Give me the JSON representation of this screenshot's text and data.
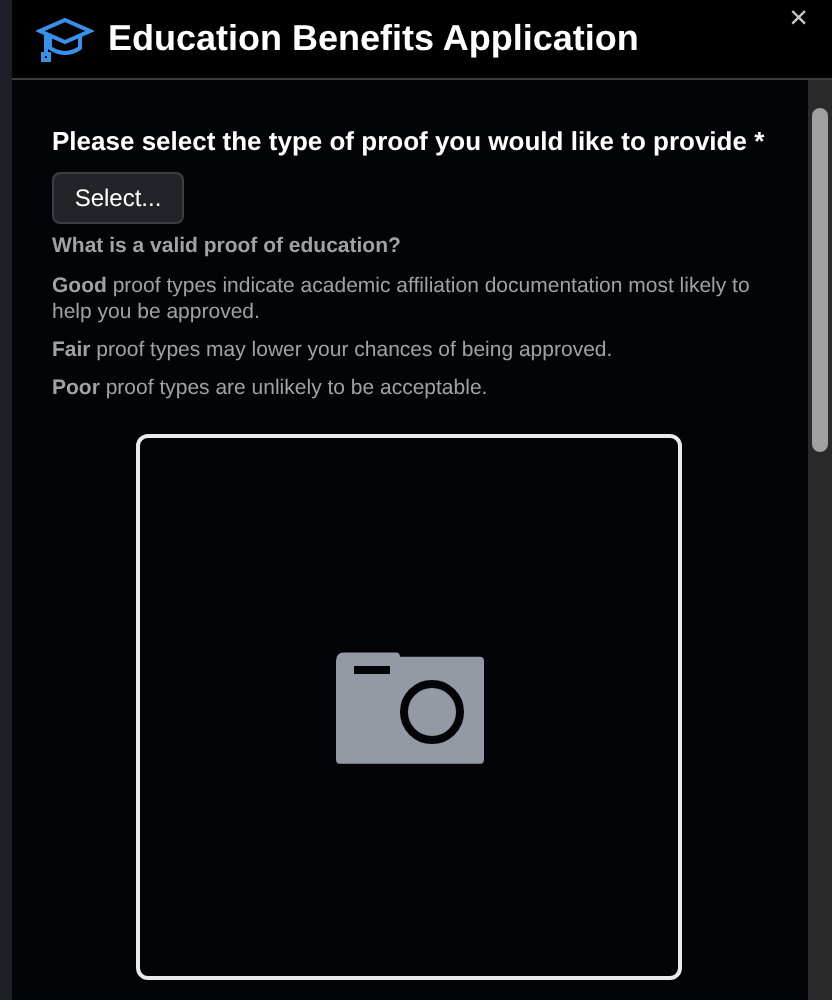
{
  "dialog": {
    "title": "Education Benefits Application",
    "close": "×"
  },
  "form": {
    "question": "Please select the type of proof you would like to provide *",
    "select_button": "Select...",
    "help_title": "What is a valid proof of education?",
    "help_items": [
      {
        "level": "Good",
        "text": "proof types indicate academic affiliation documentation most likely to help you be approved."
      },
      {
        "level": "Fair",
        "text": "proof types may lower your chances of being approved."
      },
      {
        "level": "Poor",
        "text": "proof types are unlikely to be acceptable."
      }
    ]
  }
}
